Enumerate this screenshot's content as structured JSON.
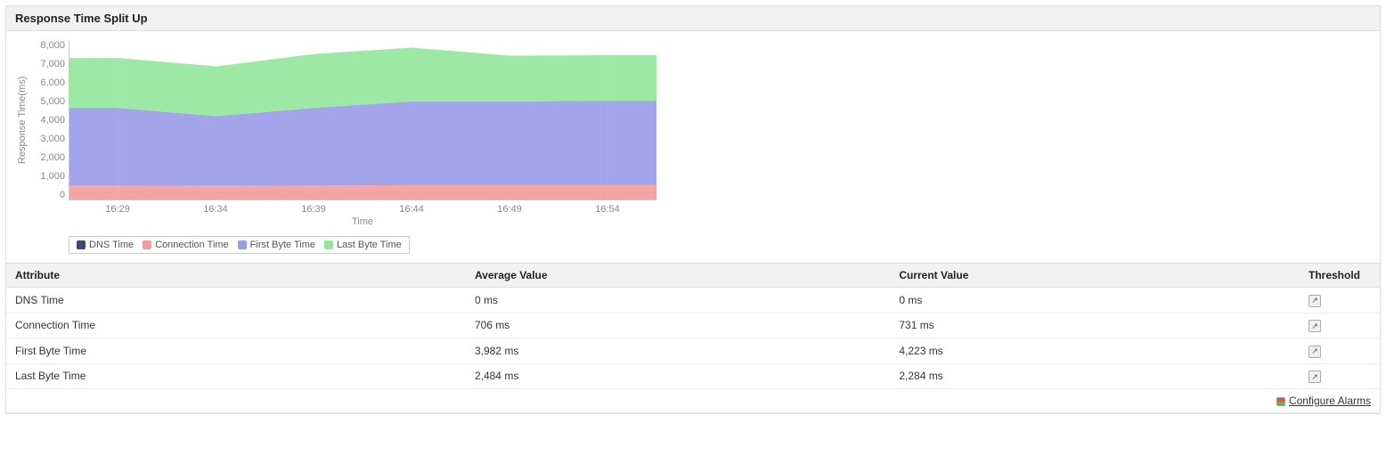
{
  "panel": {
    "title": "Response Time Split Up"
  },
  "chart_data": {
    "type": "area",
    "stacked": true,
    "xlabel": "Time",
    "ylabel": "Response Time(ms)",
    "ylim": [
      0,
      8000
    ],
    "yticks": [
      "8,000",
      "7,000",
      "6,000",
      "5,000",
      "4,000",
      "3,000",
      "2,000",
      "1,000",
      "0"
    ],
    "x": [
      "16:29",
      "16:34",
      "16:39",
      "16:44",
      "16:49",
      "16:54"
    ],
    "series": [
      {
        "name": "DNS Time",
        "color": "#3b4a6b",
        "values": [
          0,
          0,
          0,
          0,
          0,
          0
        ]
      },
      {
        "name": "Connection Time",
        "color": "#f49a9a",
        "values": [
          700,
          680,
          700,
          720,
          720,
          731
        ]
      },
      {
        "name": "First Byte Time",
        "color": "#9a9ae8",
        "values": [
          3900,
          3500,
          3900,
          4200,
          4200,
          4223
        ]
      },
      {
        "name": "Last Byte Time",
        "color": "#94e69c",
        "values": [
          2500,
          2500,
          2700,
          2700,
          2300,
          2284
        ]
      }
    ],
    "legend_position": "bottom"
  },
  "table": {
    "columns": [
      "Attribute",
      "Average Value",
      "Current Value",
      "Threshold"
    ],
    "rows": [
      {
        "attr": "DNS Time",
        "avg": "0 ms",
        "cur": "0 ms"
      },
      {
        "attr": "Connection Time",
        "avg": "706 ms",
        "cur": "731 ms"
      },
      {
        "attr": "First Byte Time",
        "avg": "3,982 ms",
        "cur": "4,223 ms"
      },
      {
        "attr": "Last Byte Time",
        "avg": "2,484 ms",
        "cur": "2,284 ms"
      }
    ]
  },
  "footer": {
    "configure_label": "Configure Alarms"
  }
}
